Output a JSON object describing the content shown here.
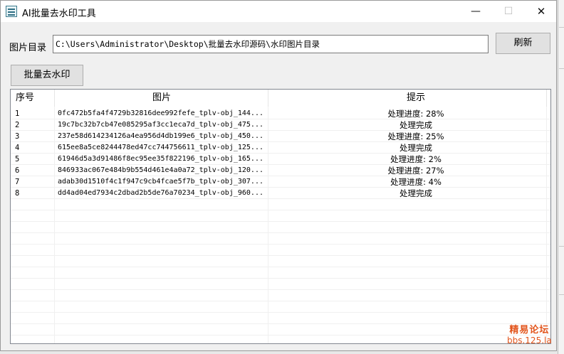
{
  "window": {
    "title": "AI批量去水印工具",
    "controls": {
      "minimize": "—",
      "maximize": "☐",
      "close": "✕"
    }
  },
  "form": {
    "dir_label": "图片目录",
    "dir_value": "C:\\Users\\Administrator\\Desktop\\批量去水印源码\\水印图片目录",
    "refresh_label": "刷新",
    "batch_label": "批量去水印"
  },
  "list": {
    "columns": [
      "序号",
      "图片",
      "提示"
    ],
    "rows": [
      {
        "idx": "1",
        "image": "0fc472b5fa4f4729b32816dee992fefe_tplv-obj_144...",
        "tip": "处理进度: 28%"
      },
      {
        "idx": "2",
        "image": "19c7bc32b7cb47e085295af3cc1eca7d_tplv-obj_475...",
        "tip": "处理完成"
      },
      {
        "idx": "3",
        "image": "237e58d614234126a4ea956d4db199e6_tplv-obj_450...",
        "tip": "处理进度: 25%"
      },
      {
        "idx": "4",
        "image": "615ee8a5ce8244478ed47cc744756611_tplv-obj_125...",
        "tip": "处理完成"
      },
      {
        "idx": "5",
        "image": "61946d5a3d91486f8ec95ee35f822196_tplv-obj_165...",
        "tip": "处理进度: 2%"
      },
      {
        "idx": "6",
        "image": "846933ac067e484b9b554d461e4a0a72_tplv-obj_120...",
        "tip": "处理进度: 27%"
      },
      {
        "idx": "7",
        "image": "adab30d1510f4c1f947c9cb4fcae5f7b_tplv-obj_307...",
        "tip": "处理进度: 4%"
      },
      {
        "idx": "8",
        "image": "dd4ad04ed7934c2dbad2b5de76a70234_tplv-obj_960...",
        "tip": "处理完成"
      }
    ]
  },
  "watermark": {
    "line1": "精易论坛",
    "line2": "bbs.125.la"
  },
  "colors": {
    "watermark": "#e2541b",
    "window_bg": "#f0f0f0",
    "button_bg": "#e1e1e1"
  }
}
